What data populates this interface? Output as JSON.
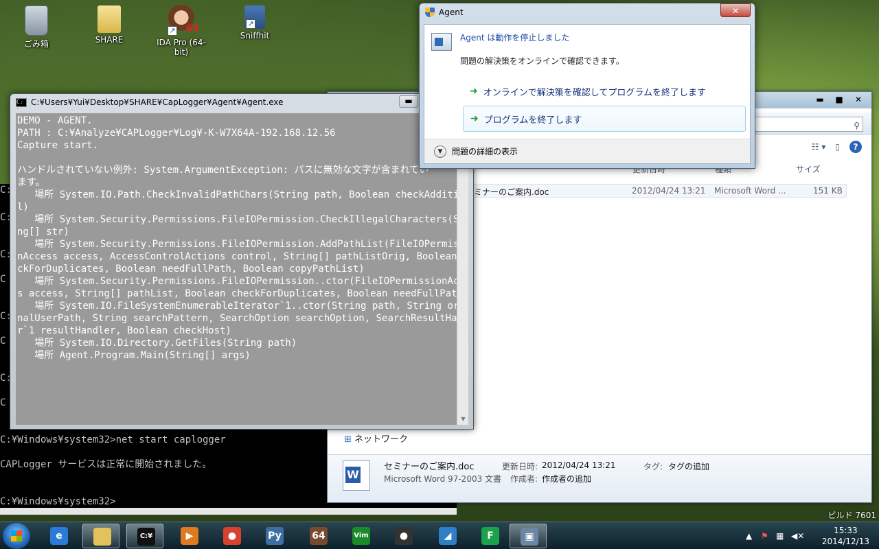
{
  "desktop": {
    "icons": [
      {
        "label": "ごみ箱",
        "icon": "recycle-bin-icon"
      },
      {
        "label": "SHARE",
        "icon": "folder-icon"
      },
      {
        "label": "IDA Pro (64-bit)",
        "icon": "ida-pro-icon",
        "badge": "64"
      },
      {
        "label": "Sniffhit",
        "icon": "network-icon"
      }
    ],
    "build_label": "ビルド 7601"
  },
  "background_cmd": {
    "lines": [
      "C:",
      "C:",
      "C:",
      "C",
      "C:",
      "C",
      "C:",
      "C",
      "C:¥Windows¥system32>net start caplogger",
      "CAPLogger サービスは正常に開始されました。",
      "C:¥Windows¥system32>"
    ]
  },
  "explorer": {
    "search_placeholder": "索",
    "columns": {
      "modified": "更新日時",
      "type": "種類",
      "size": "サイズ"
    },
    "file_row": {
      "name": "ミナーのご案内.doc",
      "modified": "2012/04/24 13:21",
      "type": "Microsoft Word ...",
      "size": "151 KB"
    },
    "nav_network": "ネットワーク",
    "details": {
      "filename": "セミナーのご案内.doc",
      "filetype": "Microsoft Word 97-2003 文書",
      "modified_label": "更新日時:",
      "modified_value": "2012/04/24 13:21",
      "tags_label": "タグ:",
      "tags_value": "タグの追加",
      "author_label": "作成者:",
      "author_value": "作成者の追加"
    }
  },
  "agent_console": {
    "title": "C:¥Users¥Yui¥Desktop¥SHARE¥CapLogger¥Agent¥Agent.exe",
    "icon_text": "C:¥_",
    "lines": [
      "DEMO - AGENT.",
      "PATH : C:¥Analyze¥CAPLogger¥Log¥-K-W7X64A-192.168.12.56",
      "Capture start.",
      "",
      "ハンドルされていない例外: System.ArgumentException: パスに無効な文字が含まれてい",
      "ます。",
      "   場所 System.IO.Path.CheckInvalidPathChars(String path, Boolean checkAdditiona",
      "l)",
      "   場所 System.Security.Permissions.FileIOPermission.CheckIllegalCharacters(Stri",
      "ng[] str)",
      "   場所 System.Security.Permissions.FileIOPermission.AddPathList(FileIOPermissio",
      "nAccess access, AccessControlActions control, String[] pathListOrig, Boolean che",
      "ckForDuplicates, Boolean needFullPath, Boolean copyPathList)",
      "   場所 System.Security.Permissions.FileIOPermission..ctor(FileIOPermissionAcces",
      "s access, String[] pathList, Boolean checkForDuplicates, Boolean needFullPath)",
      "   場所 System.IO.FileSystemEnumerableIterator`1..ctor(String path, String origi",
      "nalUserPath, String searchPattern, SearchOption searchOption, SearchResultHandle",
      "r`1 resultHandler, Boolean checkHost)",
      "   場所 System.IO.Directory.GetFiles(String path)",
      "   場所 Agent.Program.Main(String[] args)"
    ]
  },
  "agent_dialog": {
    "title": "Agent",
    "close_label": "✕",
    "heading": "Agent は動作を停止しました",
    "subtext": "問題の解決策をオンラインで確認できます。",
    "option_online": "オンラインで解決策を確認してプログラムを終了します",
    "option_close": "プログラムを終了します",
    "details_toggle": "問題の詳細の表示"
  },
  "taskbar": {
    "items": [
      {
        "icon": "internet-explorer-icon",
        "glyph": "e",
        "color": "#2a7ad6"
      },
      {
        "icon": "file-explorer-icon",
        "glyph": "",
        "color": "#e2c25a"
      },
      {
        "icon": "command-prompt-icon",
        "glyph": "C:¥",
        "color": "#111111"
      },
      {
        "icon": "media-player-icon",
        "glyph": "▶",
        "color": "#e07a1e"
      },
      {
        "icon": "chrome-icon",
        "glyph": "●",
        "color": "#d8412f"
      },
      {
        "icon": "python-icon",
        "glyph": "Py",
        "color": "#3e6fa3"
      },
      {
        "icon": "ida-pro-icon",
        "glyph": "64",
        "color": "#7a4a2e"
      },
      {
        "icon": "vim-icon",
        "glyph": "Vim",
        "color": "#1a8a2a"
      },
      {
        "icon": "spy-icon",
        "glyph": "●",
        "color": "#333333"
      },
      {
        "icon": "wireshark-icon",
        "glyph": "◢",
        "color": "#2f7fc4"
      },
      {
        "icon": "green-diamond-icon",
        "glyph": "F",
        "color": "#1aa34a"
      },
      {
        "icon": "agent-window-icon",
        "glyph": "▣",
        "color": "#6c86a3"
      }
    ],
    "clock_time": "15:33",
    "clock_date": "2014/12/13"
  }
}
